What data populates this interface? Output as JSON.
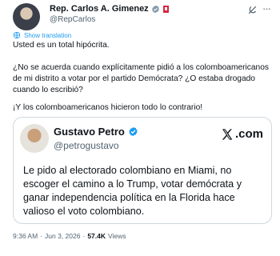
{
  "author": {
    "name": "Rep. Carlos A. Gimenez",
    "handle": "@RepCarlos"
  },
  "translate_label": "Show translation",
  "tweet": {
    "paragraphs": [
      "Usted es un total hipócrita.",
      "¿No se acuerda cuando explícitamente pidió a los colomboamericanos de mi distrito a votar por el partido Demócrata? ¿O estaba drogado cuando lo escribió?",
      "¡Y los colomboamericanos hicieron todo lo contrario!"
    ]
  },
  "quote": {
    "name": "Gustavo Petro",
    "handle": "@petrogustavo",
    "source_label": ".com",
    "text": "Le pido al electorado colombiano en Miami, no escoger el camino a lo Trump, votar demócrata y ganar independencia política en la Florida hace valioso el voto colombiano."
  },
  "meta": {
    "time": "9:36 AM",
    "separator": "·",
    "date": "Jun 3, 2026",
    "views_count": "57.4K",
    "views_label": "Views"
  },
  "colors": {
    "verified": "#1d9bf0",
    "link": "#1d9bf0",
    "flag": "#d7263d"
  }
}
